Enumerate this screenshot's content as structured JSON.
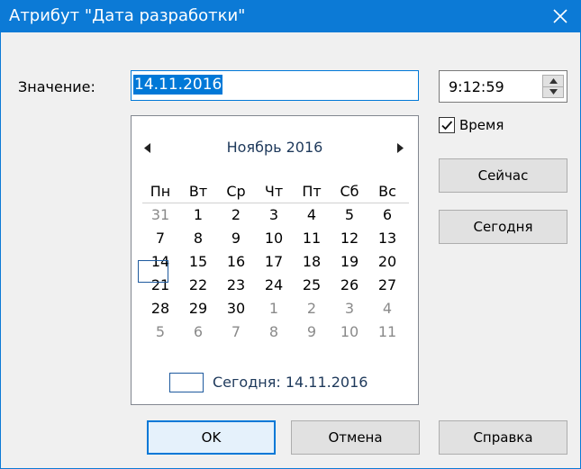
{
  "window": {
    "title": "Атрибут \"Дата разработки\""
  },
  "form": {
    "value_label": "Значение:",
    "value": "14.11.2016",
    "time": "9:12:59",
    "time_checkbox_label": "Время",
    "time_checked": true
  },
  "calendar": {
    "month_title": "Ноябрь 2016",
    "weekdays": [
      "Пн",
      "Вт",
      "Ср",
      "Чт",
      "Пт",
      "Сб",
      "Вс"
    ],
    "weeks": [
      [
        "31",
        "1",
        "2",
        "3",
        "4",
        "5",
        "6"
      ],
      [
        "7",
        "8",
        "9",
        "10",
        "11",
        "12",
        "13"
      ],
      [
        "14",
        "15",
        "16",
        "17",
        "18",
        "19",
        "20"
      ],
      [
        "21",
        "22",
        "23",
        "24",
        "25",
        "26",
        "27"
      ],
      [
        "28",
        "29",
        "30",
        "1",
        "2",
        "3",
        "4"
      ],
      [
        "5",
        "6",
        "7",
        "8",
        "9",
        "10",
        "11"
      ]
    ],
    "selected_day": "14",
    "today_label": "Сегодня: 14.11.2016"
  },
  "buttons": {
    "now": "Сейчас",
    "today": "Сегодня",
    "ok": "OK",
    "cancel": "Отмена",
    "help": "Справка"
  }
}
